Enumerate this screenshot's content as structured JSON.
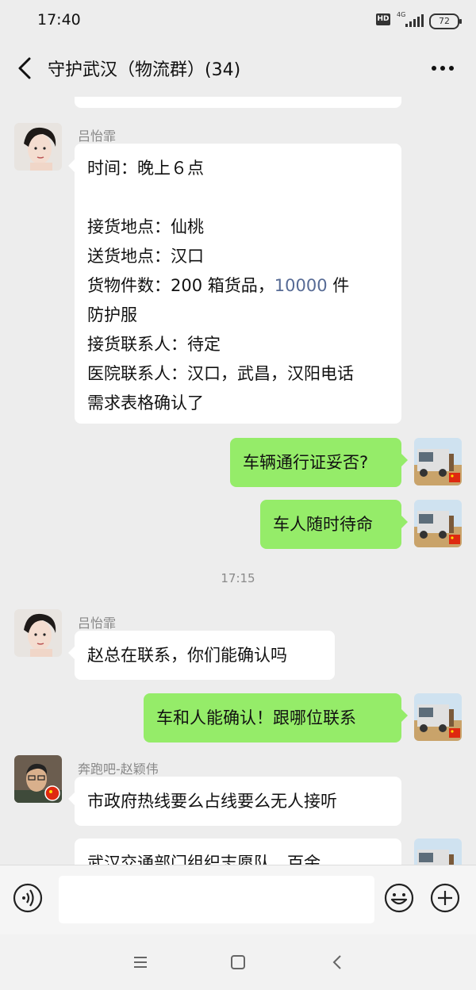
{
  "status": {
    "time": "17:40",
    "hd": "HD",
    "network": "4G",
    "battery": "72"
  },
  "header": {
    "title": "守护武汉（物流群）(34)"
  },
  "messages": [
    {
      "sender": "吕怡霏",
      "lines": [
        "时间：晚上６点",
        "",
        "接货地点：仙桃",
        "送货地点：汉口",
        "货物件数：200 箱货品，",
        "防护服",
        "接货联系人：待定",
        "医院联系人：汉口，武昌，汉阳电话",
        "需求表格确认了"
      ],
      "number": "10000",
      "number_suffix": " 件"
    },
    {
      "text": "车辆通行证妥否?"
    },
    {
      "text": "车人随时待命"
    },
    {
      "timestamp": "17:15"
    },
    {
      "sender": "吕怡霏",
      "text": "赵总在联系，你们能确认吗"
    },
    {
      "text": "车和人能确认！跟哪位联系"
    },
    {
      "sender": "奔跑吧-赵颖伟",
      "text": "市政府热线要么占线要么无人接听"
    },
    {
      "text": "武汉交通部门组织志愿队，百余"
    }
  ]
}
